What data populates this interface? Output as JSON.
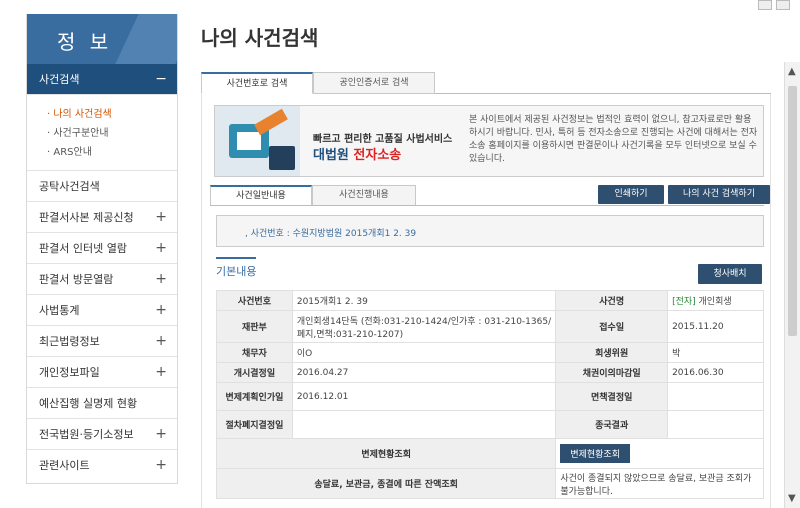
{
  "sidebar": {
    "title": "정 보",
    "active": {
      "label": "사건검색",
      "sign": "−"
    },
    "sub_items": [
      "· 나의 사건검색",
      "· 사건구분안내",
      "· ARS안내"
    ],
    "items": [
      {
        "label": "공탁사건검색",
        "sign": ""
      },
      {
        "label": "판결서사본 제공신청",
        "sign": "+"
      },
      {
        "label": "판결서 인터넷 열람",
        "sign": "+"
      },
      {
        "label": "판결서 방문열람",
        "sign": "+"
      },
      {
        "label": "사법통계",
        "sign": "+"
      },
      {
        "label": "최근법령정보",
        "sign": "+"
      },
      {
        "label": "개인정보파일",
        "sign": "+"
      },
      {
        "label": "예산집행 실명제 현황",
        "sign": ""
      },
      {
        "label": "전국법원·등기소정보",
        "sign": "+"
      },
      {
        "label": "관련사이트",
        "sign": "+"
      }
    ]
  },
  "page": {
    "title": "나의 사건검색"
  },
  "tabs": {
    "t1": "사건번호로 검색",
    "t2": "공인인증서로 검색"
  },
  "banner": {
    "line1": "빠르고 편리한 고품질 사법서비스",
    "line2a": "대법원 ",
    "line2b": "전자소송",
    "desc": "본 사이트에서 제공된 사건정보는 법적인 효력이 없으니, 참고자료로만 활용하시기 바랍니다. 민사, 특허 등 전자소송으로 진행되는 사건에 대해서는 전자소송 홈페이지를 이용하시면 판결문이나 사건기록을 모두 인터넷으로 보실 수 있습니다."
  },
  "subtabs": {
    "s1": "사건일반내용",
    "s2": "사건진행내용"
  },
  "buttons": {
    "print": "인쇄하기",
    "mycase": "나의 사건 검색하기",
    "recheck": "청사배치",
    "refund": "변제현황조회"
  },
  "case": {
    "line": ", 사건번호 : 수원지방법원 2015개회1  2. 39"
  },
  "section": {
    "title": "기본내용"
  },
  "table": {
    "r1": {
      "l1": "사건번호",
      "v1": "2015개회1  2. 39",
      "l2": "사건명",
      "tag": "[전자]",
      "v2": " 개인회생"
    },
    "r2": {
      "l1": "재판부",
      "v1": "개인회생14단독 (전화:031-210-1424/인가후 : 031-210-1365/폐지,면책:031-210-1207)",
      "l2": "접수일",
      "v2": "2015.11.20"
    },
    "r3": {
      "l1": "채무자",
      "v1": "이O",
      "l2": "회생위원",
      "v2": "박"
    },
    "r4": {
      "l1": "개시결정일",
      "v1": "2016.04.27",
      "l2": "채권이의마감일",
      "v2": "2016.06.30"
    },
    "r5": {
      "l1": "변제계획인가일",
      "v1": "2016.12.01",
      "l2": "면책결정일",
      "v2": ""
    },
    "r6": {
      "l1": "절차폐지결정일",
      "v1": "",
      "l2": "종국결과",
      "v2": ""
    },
    "r7": {
      "l1": "변제현황조회"
    },
    "r8": {
      "l1": "송달료, 보관금, 종결에 따른 잔액조회",
      "v1": "사건이 종결되지 않았으므로 송달료, 보관금 조회가 불가능합니다."
    }
  }
}
